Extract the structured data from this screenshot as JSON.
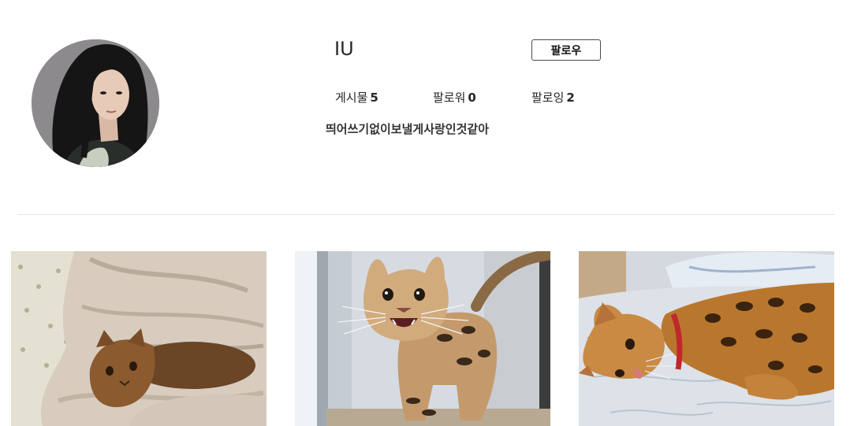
{
  "profile": {
    "username": "IU",
    "follow_label": "팔로우",
    "bio": "띄어쓰기없이보낼게사랑인것같아"
  },
  "stats": {
    "posts_label": "게시물",
    "posts_count": "5",
    "followers_label": "팔로워",
    "followers_count": "0",
    "following_label": "팔로잉",
    "following_count": "2"
  },
  "posts": [
    {
      "subject": "bengal cat under blanket"
    },
    {
      "subject": "bengal cat meowing"
    },
    {
      "subject": "bengal cat lying on bed"
    }
  ],
  "colors": {
    "text": "#262626",
    "divider": "#e6e6e6",
    "button_border": "#4a4a4a"
  }
}
